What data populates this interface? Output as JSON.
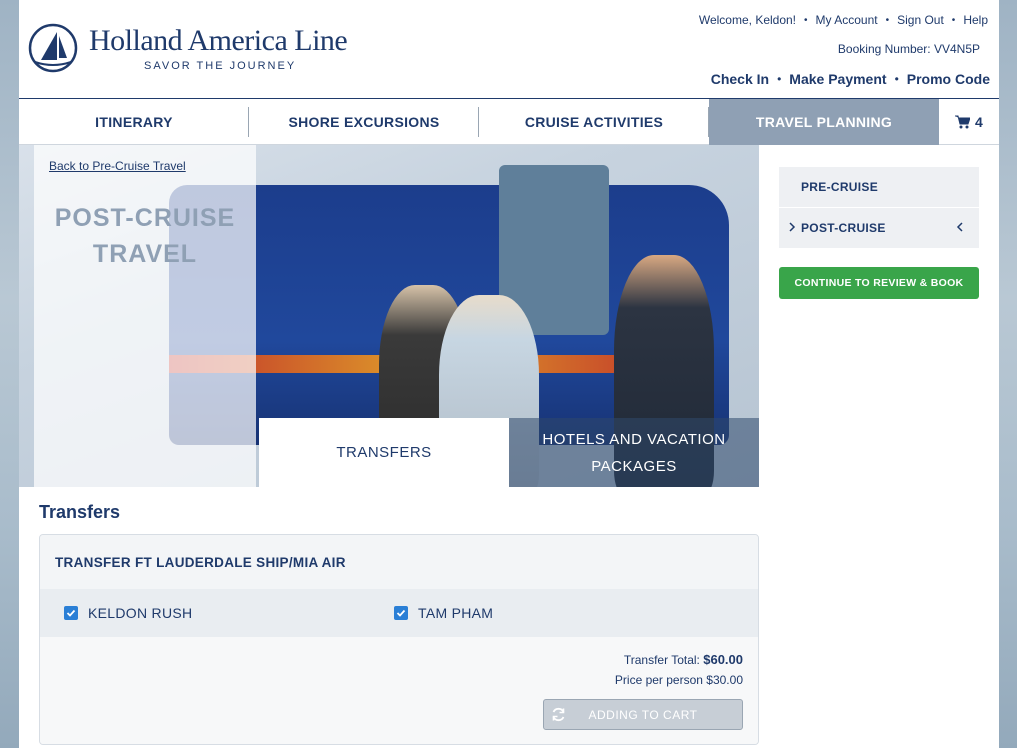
{
  "brand": {
    "name": "Holland America Line",
    "tagline": "SAVOR THE JOURNEY"
  },
  "header": {
    "welcome": "Welcome, Keldon!",
    "links": [
      "My Account",
      "Sign Out",
      "Help"
    ],
    "booking": "Booking Number: VV4N5P",
    "actions": [
      "Check In",
      "Make Payment",
      "Promo Code"
    ]
  },
  "nav": {
    "items": [
      "ITINERARY",
      "SHORE EXCURSIONS",
      "CRUISE ACTIVITIES",
      "TRAVEL PLANNING"
    ],
    "active_index": 3,
    "cart_count": "4"
  },
  "hero": {
    "back_link": "Back to Pre-Cruise Travel",
    "title": "POST-CRUISE TRAVEL",
    "tabs": [
      "TRANSFERS",
      "HOTELS AND VACATION PACKAGES"
    ],
    "active_tab": 0
  },
  "sidebar": {
    "items": [
      "PRE-CRUISE",
      "POST-CRUISE"
    ],
    "cta": "CONTINUE TO REVIEW & BOOK"
  },
  "transfers": {
    "section_title": "Transfers",
    "card_title": "TRANSFER FT LAUDERDALE SHIP/MIA AIR",
    "guests": [
      {
        "name": "KELDON RUSH",
        "checked": true
      },
      {
        "name": "TAM PHAM",
        "checked": true
      }
    ],
    "total_label": "Transfer Total:",
    "total_value": "$60.00",
    "price_per_person": "Price per person $30.00",
    "button_label": "ADDING TO CART"
  },
  "colors": {
    "navy": "#1f3a6b",
    "active_nav": "#8fa0b4",
    "cta_green": "#39a54a",
    "checkbox_blue": "#2a7fd6"
  }
}
